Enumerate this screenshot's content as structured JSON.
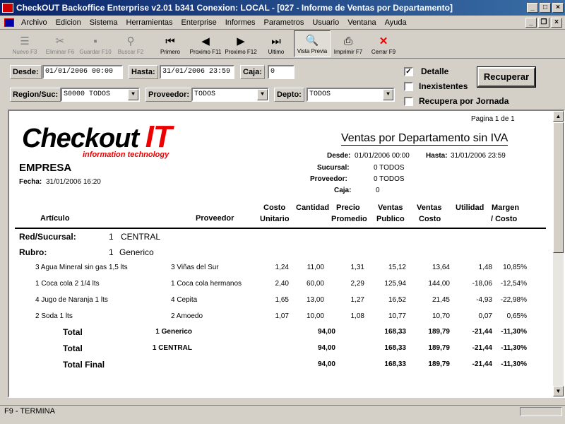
{
  "window": {
    "title": "CheckOUT Backoffice Enterprise v2.01 b341 Conexion: LOCAL - [027 - Informe de Ventas por Departamento]"
  },
  "menu": [
    "Archivo",
    "Edicion",
    "Sistema",
    "Herramientas",
    "Enterprise",
    "Informes",
    "Parametros",
    "Usuario",
    "Ventana",
    "Ayuda"
  ],
  "toolbar": {
    "nuevo": "Nuevo F3",
    "eliminar": "Eliminar F6",
    "guardar": "Guardar F10",
    "buscar": "Buscar F2",
    "primero": "Primero",
    "proximo11": "Proximo F11",
    "proximo12": "Proximo F12",
    "ultimo": "Ultimo",
    "vista_previa": "Vista Previa",
    "imprimir": "Imprimir F7",
    "cerrar": "Cerrar F9"
  },
  "filters": {
    "desde_label": "Desde:",
    "desde_value": "01/01/2006 00:00",
    "hasta_label": "Hasta:",
    "hasta_value": "31/01/2006 23:59",
    "caja_label": "Caja:",
    "caja_value": "0",
    "region_label": "Region/Suc:",
    "region_value": "S0000 TODOS",
    "proveedor_label": "Proveedor:",
    "proveedor_value": "TODOS",
    "depto_label": "Depto:",
    "depto_value": "TODOS",
    "detalle": "Detalle",
    "inexistentes": "Inexistentes",
    "recupera_jornada": "Recupera por Jornada",
    "recuperar": "Recuperar"
  },
  "report": {
    "pagina": "Pagina 1 de 1",
    "logo_main": "Checkout",
    "logo_it": "IT",
    "logo_sub": "information technology",
    "title": "Ventas por Departamento sin IVA",
    "empresa": "EMPRESA",
    "fecha_label": "Fecha:",
    "fecha_value": "31/01/2006 16:20",
    "desde_label": "Desde:",
    "desde_value": "01/01/2006 00:00",
    "hasta_label": "Hasta:",
    "hasta_value": "31/01/2006 23:59",
    "sucursal_label": "Sucursal:",
    "sucursal_value": "0 TODOS",
    "proveedor_label": "Proveedor:",
    "proveedor_value": "0 TODOS",
    "caja_label": "Caja:",
    "caja_value": "0",
    "columns": {
      "articulo": "Artículo",
      "proveedor": "Proveedor",
      "costo1": "Costo",
      "costo2": "Unitario",
      "cantidad": "Cantidad",
      "precio1": "Precio",
      "precio2": "Promedio",
      "vpub1": "Ventas",
      "vpub2": "Publico",
      "vcos1": "Ventas",
      "vcos2": "Costo",
      "utilidad": "Utilidad",
      "margen1": "Margen",
      "margen2": "/ Costo"
    },
    "group1_label": "Red/Sucursal:",
    "group1_num": "1",
    "group1_name": "CENTRAL",
    "group2_label": "Rubro:",
    "group2_num": "1",
    "group2_name": "Generico",
    "rows": [
      {
        "articulo": "3 Agua Mineral sin gas 1,5 lts",
        "proveedor": "3 Viñas del Sur",
        "costo": "1,24",
        "cantidad": "11,00",
        "precio": "1,31",
        "vpub": "15,12",
        "vcos": "13,64",
        "util": "1,48",
        "margen": "10,85%"
      },
      {
        "articulo": "1 Coca cola 2 1/4 lts",
        "proveedor": "1 Coca cola hermanos",
        "costo": "2,40",
        "cantidad": "60,00",
        "precio": "2,29",
        "vpub": "125,94",
        "vcos": "144,00",
        "util": "-18,06",
        "margen": "-12,54%"
      },
      {
        "articulo": "4 Jugo de Naranja 1 lts",
        "proveedor": "4 Cepita",
        "costo": "1,65",
        "cantidad": "13,00",
        "precio": "1,27",
        "vpub": "16,52",
        "vcos": "21,45",
        "util": "-4,93",
        "margen": "-22,98%"
      },
      {
        "articulo": "2 Soda 1 lts",
        "proveedor": "2 Amoedo",
        "costo": "1,07",
        "cantidad": "10,00",
        "precio": "1,08",
        "vpub": "10,77",
        "vcos": "10,70",
        "util": "0,07",
        "margen": "0,65%"
      }
    ],
    "totals": [
      {
        "label": "Total",
        "name": "1 Generico",
        "cantidad": "94,00",
        "vpub": "168,33",
        "vcos": "189,79",
        "util": "-21,44",
        "margen": "-11,30%"
      },
      {
        "label": "Total",
        "name": "1 CENTRAL",
        "cantidad": "94,00",
        "vpub": "168,33",
        "vcos": "189,79",
        "util": "-21,44",
        "margen": "-11,30%"
      },
      {
        "label": "Total Final",
        "name": "",
        "cantidad": "94,00",
        "vpub": "168,33",
        "vcos": "189,79",
        "util": "-21,44",
        "margen": "-11,30%"
      }
    ]
  },
  "status": {
    "text": "F9 - TERMINA"
  }
}
